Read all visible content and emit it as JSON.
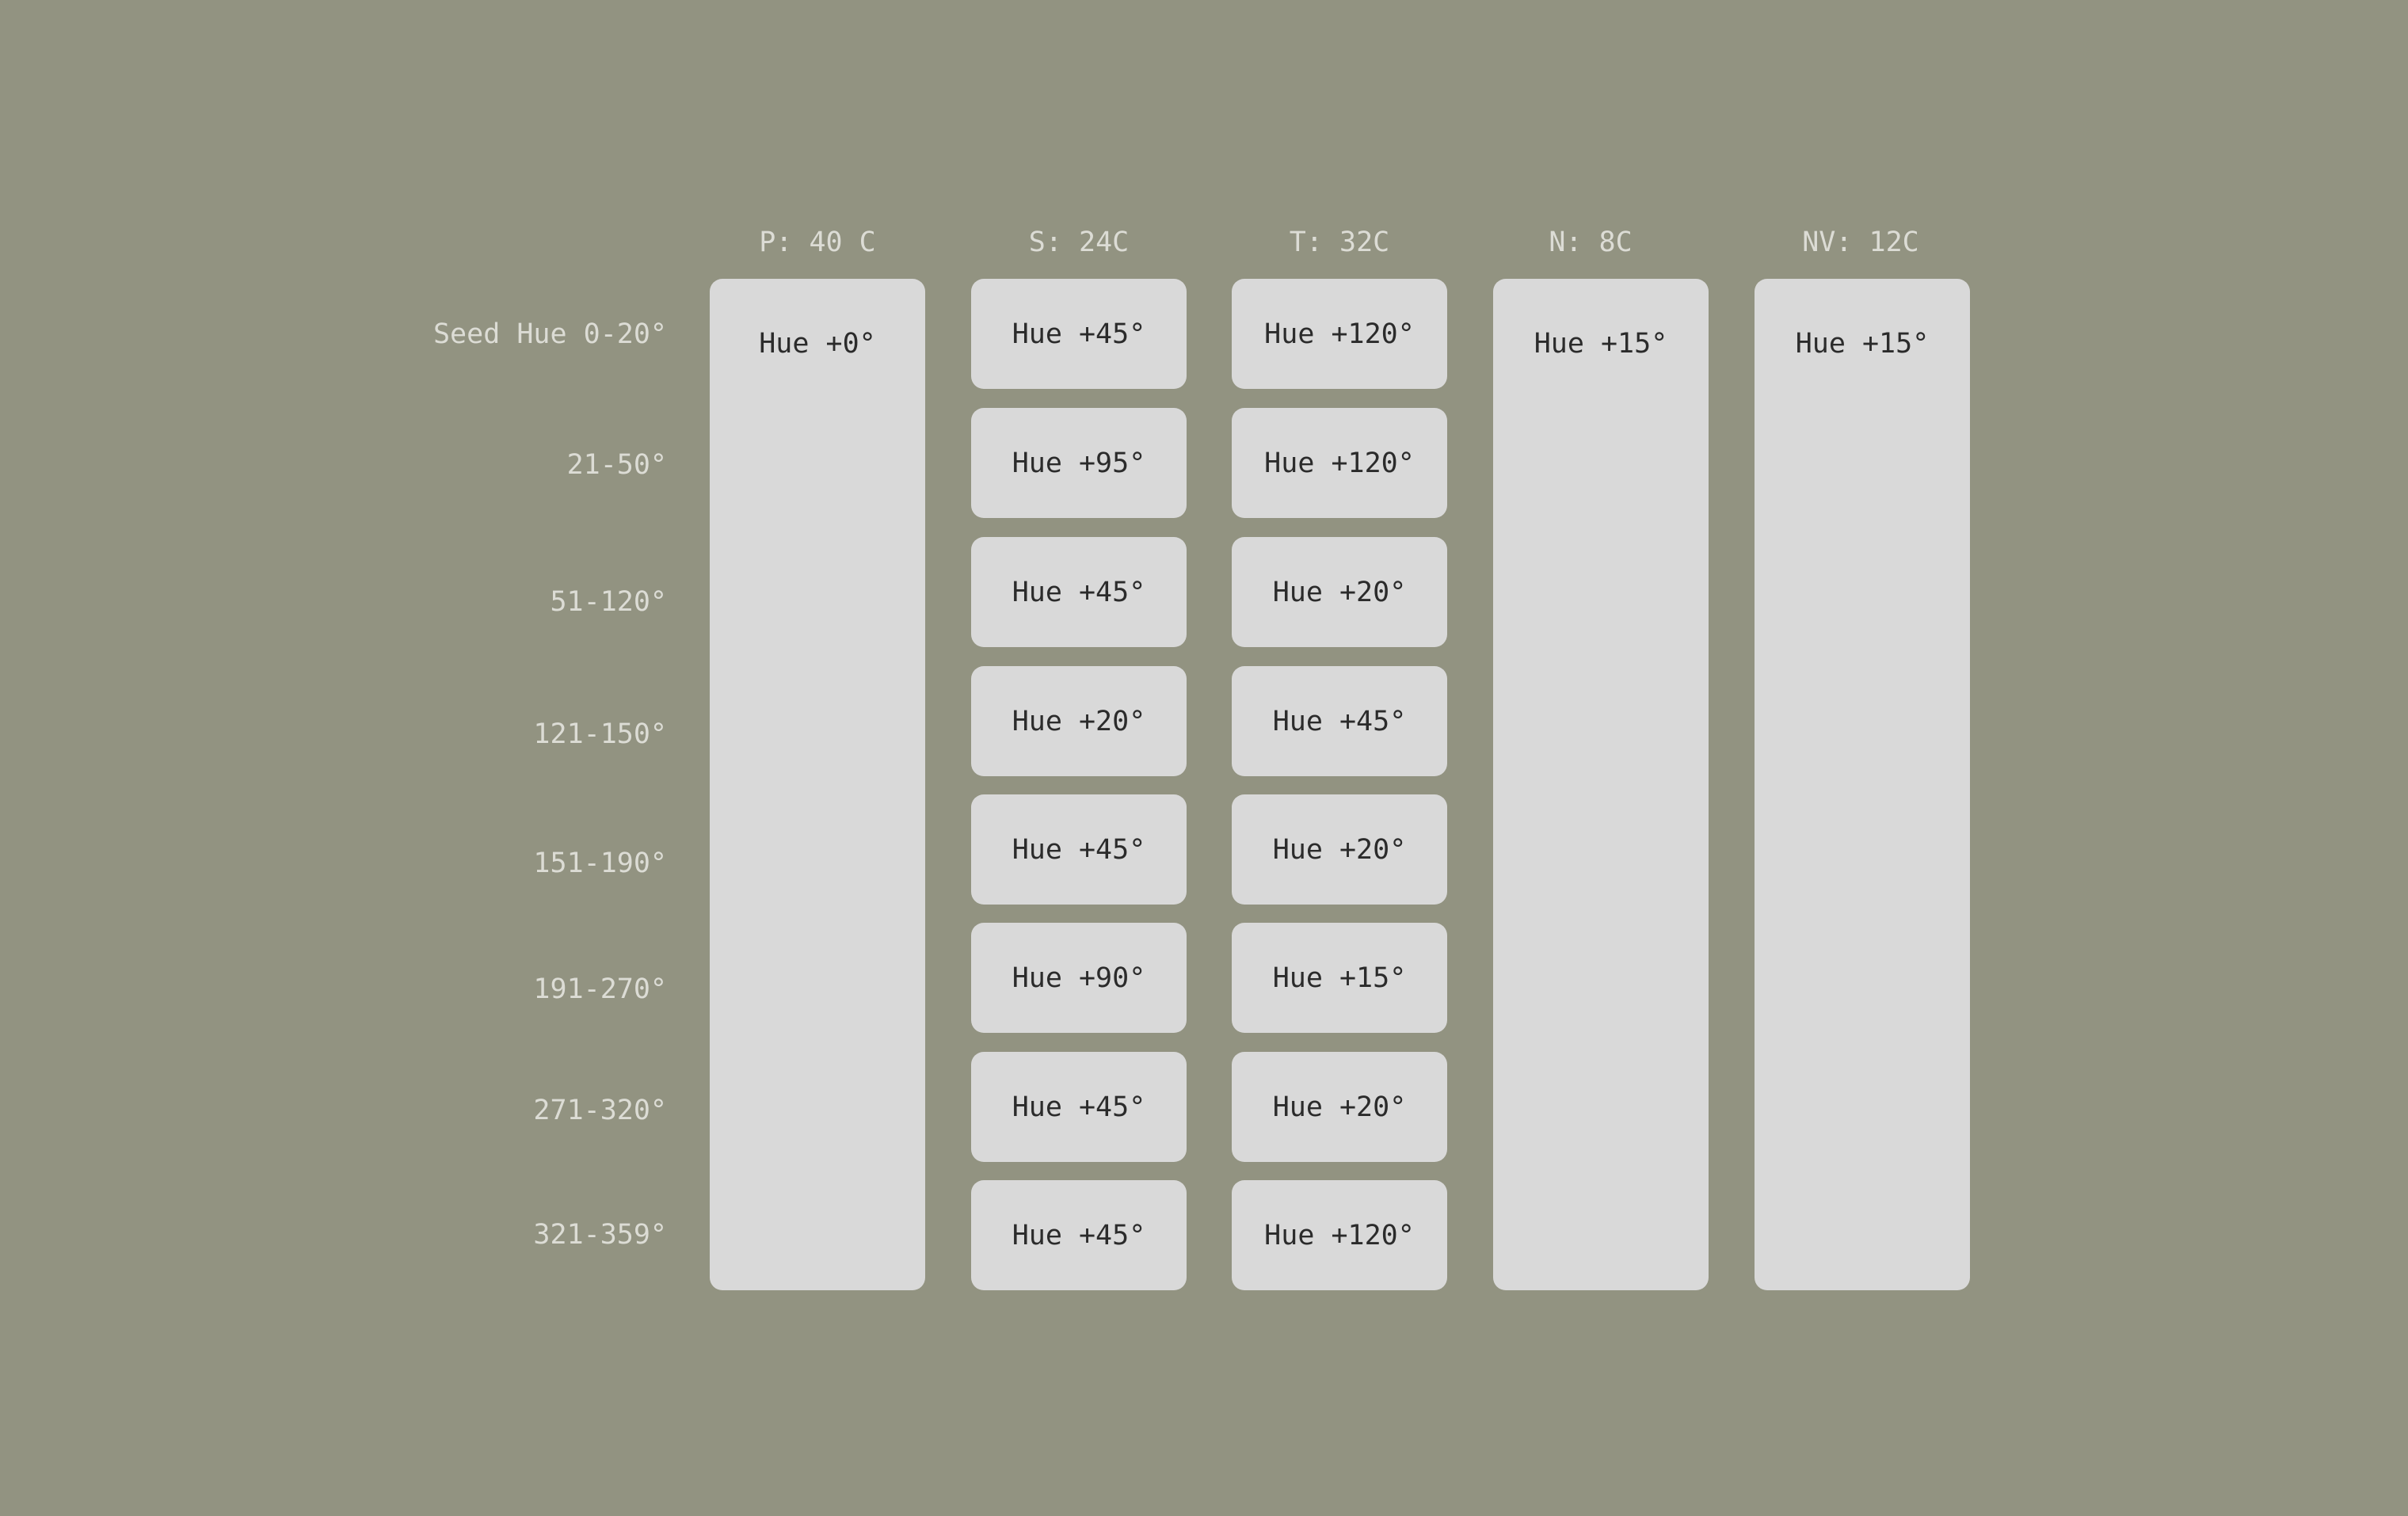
{
  "columns": {
    "primary": {
      "header": "P: 40 C",
      "value": "Hue +0°"
    },
    "secondary": {
      "header": "S: 24C",
      "values": [
        "Hue +45°",
        "Hue +95°",
        "Hue +45°",
        "Hue +20°",
        "Hue +45°",
        "Hue +90°",
        "Hue +45°",
        "Hue +45°"
      ]
    },
    "tertiary": {
      "header": "T: 32C",
      "values": [
        "Hue +120°",
        "Hue +120°",
        "Hue +20°",
        "Hue +45°",
        "Hue +20°",
        "Hue +15°",
        "Hue +20°",
        "Hue +120°"
      ]
    },
    "neutral": {
      "header": "N: 8C",
      "value": "Hue +15°"
    },
    "neutral_variant": {
      "header": "NV: 12C",
      "value": "Hue +15°"
    }
  },
  "rows": [
    "Seed Hue 0-20°",
    "21-50°",
    "51-120°",
    "121-150°",
    "151-190°",
    "191-270°",
    "271-320°",
    "321-359°"
  ],
  "colors": {
    "background": "#929381",
    "cell": "#d9d9d9",
    "cell_text": "#2b2b2b",
    "label_text": "#dcdcd5"
  }
}
